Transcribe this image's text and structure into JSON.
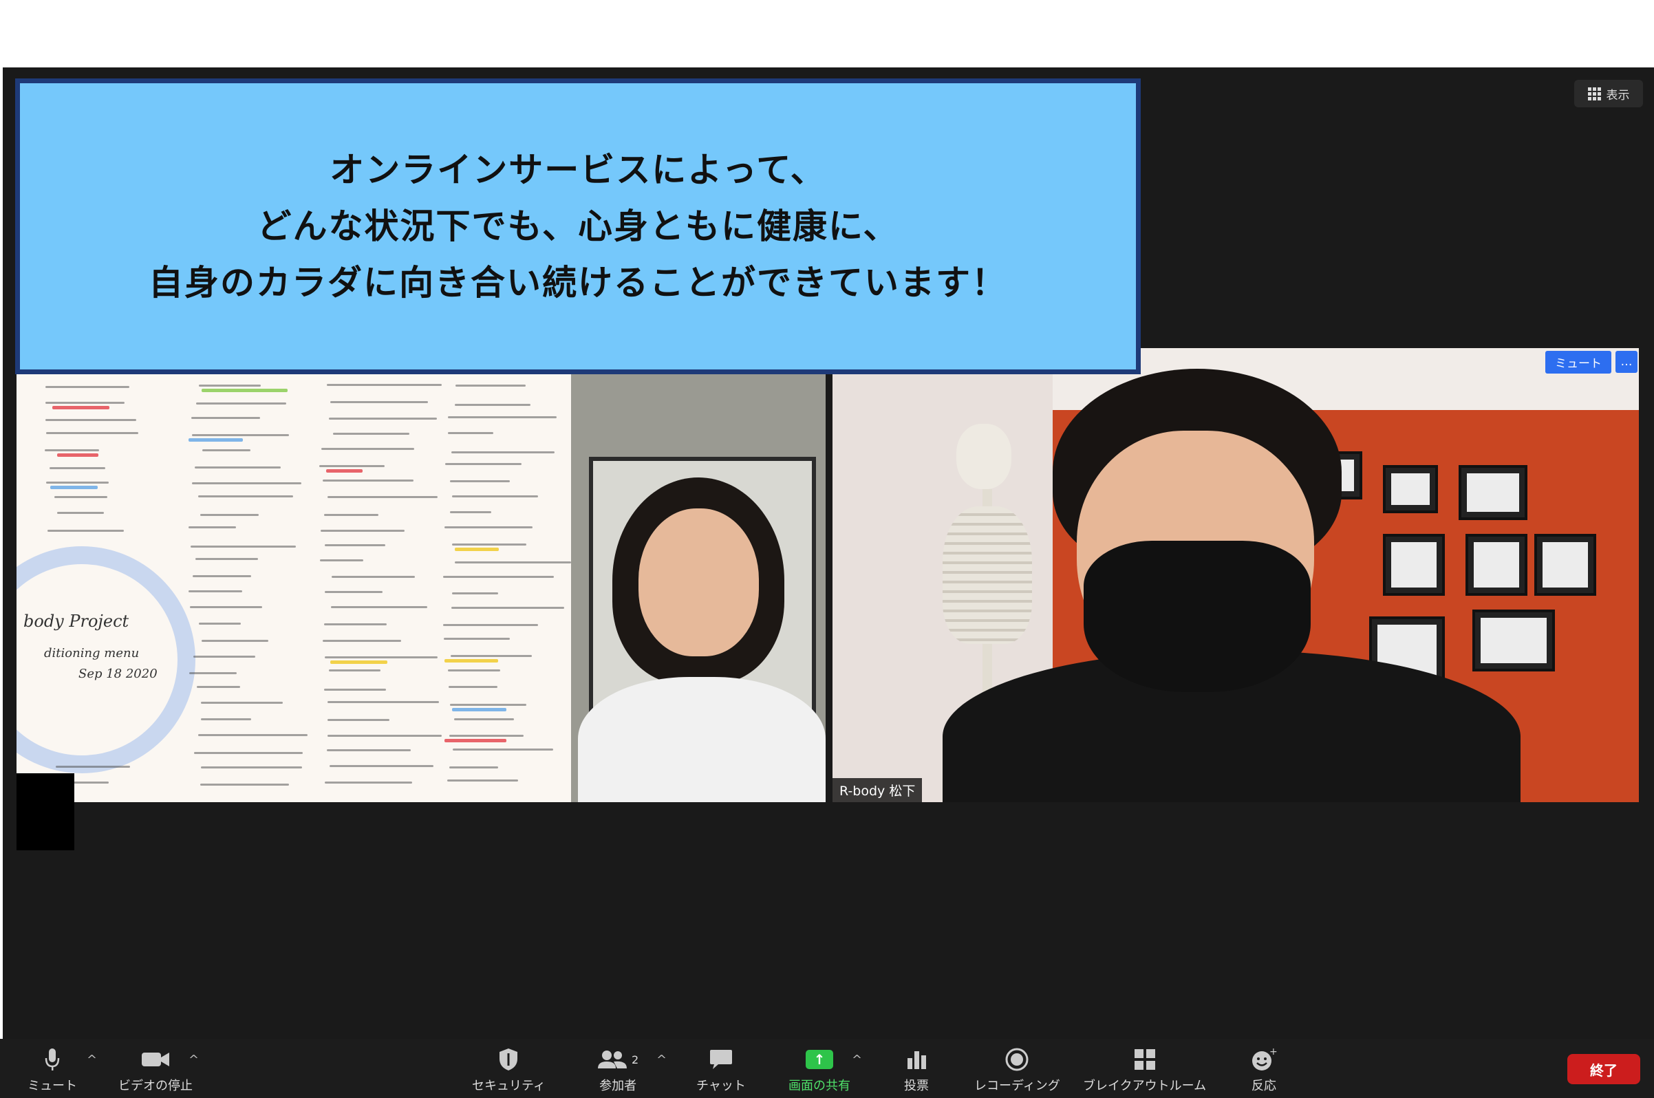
{
  "view_button": {
    "label": "表示"
  },
  "banner": {
    "lines": [
      "オンラインサービスによって、",
      "どんな状況下でも、心身ともに健康に、",
      "自身のカラダに向き合い続けることができています！"
    ]
  },
  "tiles": {
    "left": {
      "whiteboard_title": "body Project",
      "whiteboard_sub": "Sep 18 2020",
      "whiteboard_sub2": "ditioning menu"
    },
    "right": {
      "name": "R-body 松下",
      "mute_label": "ミュート",
      "more_label": "…"
    }
  },
  "toolbar": {
    "mute": {
      "label": "ミュート",
      "icon": "microphone-icon"
    },
    "video": {
      "label": "ビデオの停止",
      "icon": "video-camera-icon"
    },
    "security": {
      "label": "セキュリティ",
      "icon": "shield-icon"
    },
    "participants": {
      "label": "参加者",
      "count": "2",
      "icon": "participants-icon"
    },
    "chat": {
      "label": "チャット",
      "icon": "chat-bubble-icon"
    },
    "share": {
      "label": "画面の共有",
      "icon": "share-arrow-icon"
    },
    "poll": {
      "label": "投票",
      "icon": "bar-chart-icon"
    },
    "record": {
      "label": "レコーディング",
      "icon": "record-icon"
    },
    "breakout": {
      "label": "ブレイクアウトルーム",
      "icon": "breakout-grid-icon"
    },
    "reactions": {
      "label": "反応",
      "icon": "emoji-plus-icon"
    },
    "end": {
      "label": "終了"
    }
  },
  "colors": {
    "banner_bg": "#75c8fb",
    "banner_border": "#1e3a78",
    "share_green": "#2ec44a",
    "end_red": "#cc1d1d",
    "mute_blue": "#2d6ef0"
  }
}
